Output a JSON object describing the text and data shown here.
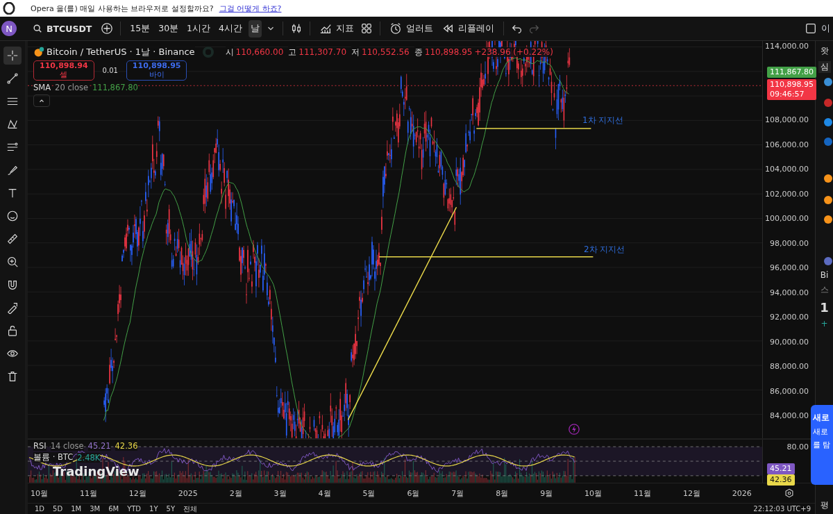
{
  "browser_bar": {
    "message": "Opera 을(를) 매일 사용하는 브라우저로 설정할까요?",
    "link": "그걸 어떻게 하죠?"
  },
  "toolbar": {
    "avatar": "N",
    "symbol": "BTCUSDT",
    "intervals": [
      {
        "label": "15분",
        "selected": false
      },
      {
        "label": "30분",
        "selected": false
      },
      {
        "label": "1시간",
        "selected": false
      },
      {
        "label": "4시간",
        "selected": false
      },
      {
        "label": "날",
        "selected": true
      }
    ],
    "indicators": "지표",
    "alert": "얼러트",
    "replay": "리플레이",
    "right_label": "이"
  },
  "tools": [
    {
      "kind": "crosshair",
      "selected": true
    },
    {
      "kind": "trendline",
      "selected": false
    },
    {
      "kind": "fib",
      "selected": false
    },
    {
      "kind": "pattern",
      "selected": false
    },
    {
      "kind": "forecast",
      "selected": false
    },
    {
      "kind": "brush",
      "selected": false
    },
    {
      "kind": "text",
      "selected": false
    },
    {
      "kind": "emoji",
      "selected": false
    },
    {
      "kind": "ruler",
      "selected": false
    },
    {
      "kind": "zoom",
      "selected": false
    },
    {
      "kind": "magnet",
      "selected": false
    },
    {
      "kind": "lockdraw",
      "selected": false
    },
    {
      "kind": "lock",
      "selected": false
    },
    {
      "kind": "eye",
      "selected": false
    },
    {
      "kind": "trash",
      "selected": false
    }
  ],
  "legend": {
    "title": "Bitcoin / TetherUS · 1날 · Binance",
    "ohlc": [
      {
        "label": "시",
        "value": "110,660.00"
      },
      {
        "label": "고",
        "value": "111,307.70"
      },
      {
        "label": "저",
        "value": "110,552.56"
      },
      {
        "label": "종",
        "value": "110,898.95"
      }
    ],
    "change": "+238.96 (+0.22%)"
  },
  "trade": {
    "sell_price": "110,898.94",
    "sell_label": "셀",
    "spread": "0.01",
    "buy_price": "110,898.95",
    "buy_label": "바이"
  },
  "sma": {
    "name": "SMA",
    "params": "20 close",
    "value": "111,867.80"
  },
  "annotations": [
    {
      "label": "1차 지지선"
    },
    {
      "label": "2차 지지선"
    }
  ],
  "price_axis": {
    "labels": [
      "114,000.00",
      "108,000.00",
      "106,000.00",
      "104,000.00",
      "102,000.00",
      "100,000.00",
      "98,000.00",
      "96,000.00",
      "94,000.00",
      "92,000.00",
      "90,000.00",
      "88,000.00",
      "86,000.00",
      "84,000.00"
    ],
    "sma_tag": "111,867.80",
    "price_tag": "110,898.95",
    "countdown": "09:46:57"
  },
  "rsi": {
    "name": "RSI",
    "params": "14 close",
    "value": "45.21",
    "ma_value": "42.36",
    "axis_label": "80.00",
    "value_tag": "45.21",
    "ma_tag": "42.36"
  },
  "volume": {
    "name": "볼륨 · BTC",
    "value": "2.48K"
  },
  "logo": "TradingView",
  "time_axis": [
    "10월",
    "11월",
    "12월",
    "2025",
    "2월",
    "3월",
    "4월",
    "5월",
    "6월",
    "7월",
    "8월",
    "9월",
    "10월",
    "11월",
    "12월",
    "2026"
  ],
  "ranges": [
    "1D",
    "5D",
    "1M",
    "3M",
    "6M",
    "YTD",
    "1Y",
    "5Y",
    "전체"
  ],
  "clock": "22:12:03 UTC+9",
  "sidebar": {
    "header": "왓",
    "tab": "심",
    "ticker": "Bi",
    "sub": "스",
    "price": "1",
    "change": "+",
    "footer": "평"
  },
  "popup": {
    "title": "새로",
    "lines": [
      "새로",
      "를 탐"
    ]
  }
}
